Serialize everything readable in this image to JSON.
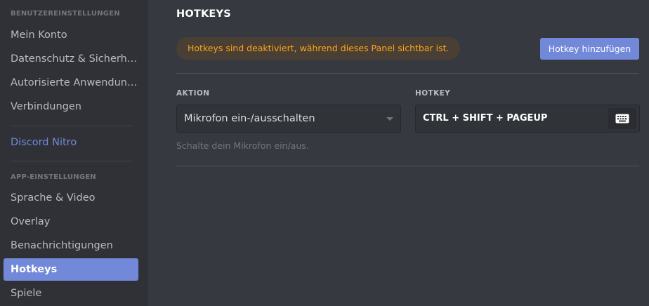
{
  "sidebar": {
    "user_settings_header": "BENUTZEREINSTELLUNGEN",
    "user_items": [
      {
        "label": "Mein Konto"
      },
      {
        "label": "Datenschutz & Sicherheit"
      },
      {
        "label": "Autorisierte Anwendungen"
      },
      {
        "label": "Verbindungen"
      }
    ],
    "nitro_label": "Discord Nitro",
    "app_settings_header": "APP-EINSTELLUNGEN",
    "app_items": [
      {
        "label": "Sprache & Video"
      },
      {
        "label": "Overlay"
      },
      {
        "label": "Benachrichtigungen"
      },
      {
        "label": "Hotkeys",
        "active": true
      },
      {
        "label": "Spiele"
      }
    ]
  },
  "main": {
    "title": "HOTKEYS",
    "warning": "Hotkeys sind deaktiviert, während dieses Panel sichtbar ist.",
    "add_button_label": "Hotkey hinzufügen",
    "action_column_label": "AKTION",
    "hotkey_column_label": "HOTKEY",
    "rows": [
      {
        "action": "Mikrofon ein-/ausschalten",
        "hotkey": "CTRL + SHIFT + PAGEUP",
        "description": "Schalte dein Mikrofon ein/aus."
      }
    ]
  },
  "icons": {
    "dropdown": "chevron-down-icon",
    "record_hotkey": "keyboard-icon"
  },
  "colors": {
    "accent": "#7289da",
    "warning_text": "#faa61a",
    "sidebar_bg": "#2f3136",
    "main_bg": "#36393f"
  }
}
